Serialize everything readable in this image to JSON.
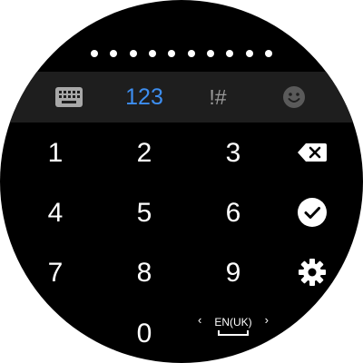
{
  "pin": {
    "dots_count": 10
  },
  "mode_bar": {
    "keyboard_icon": "keyboard-icon",
    "numbers_label": "123",
    "symbols_label": "!#",
    "emoji_icon": "emoji-icon",
    "active_color": "#3d8ef0",
    "inactive_color": "#9a9a9a",
    "bar_color": "#1e1e1e"
  },
  "keypad": {
    "k1": "1",
    "k2": "2",
    "k3": "3",
    "k4": "4",
    "k5": "5",
    "k6": "6",
    "k7": "7",
    "k8": "8",
    "k9": "9",
    "k0": "0"
  },
  "actions": {
    "backspace_icon": "backspace-icon",
    "done_icon": "check-circle-icon",
    "settings_icon": "gear-icon"
  },
  "language": {
    "label": "EN(UK)",
    "prev_arrow": "‹",
    "next_arrow": "›"
  }
}
